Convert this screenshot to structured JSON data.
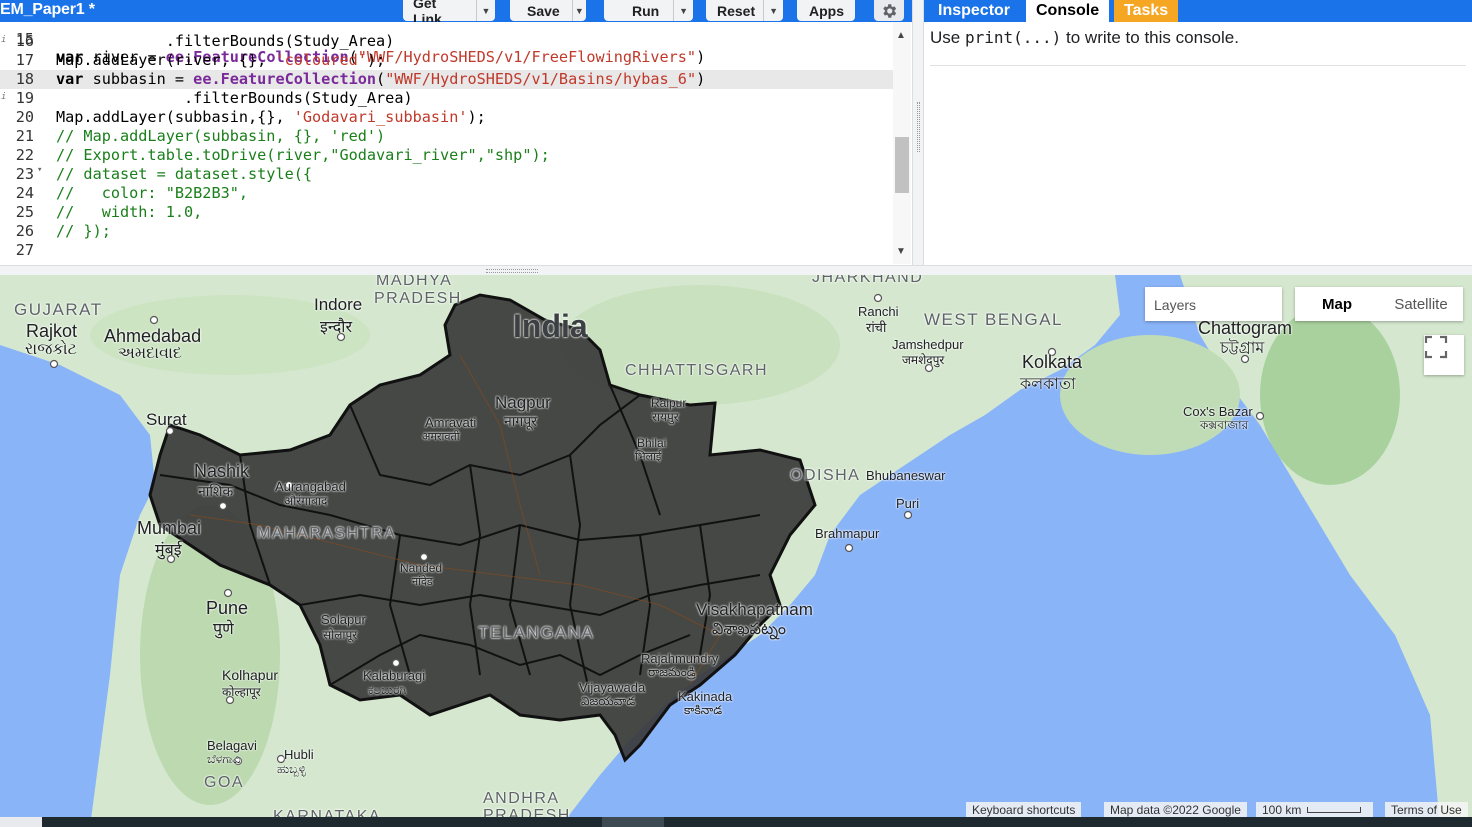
{
  "toolbar": {
    "script_title": "EM_Paper1 *",
    "get_link": "Get Link",
    "save": "Save",
    "run": "Run",
    "reset": "Reset",
    "apps": "Apps"
  },
  "editor": {
    "partial_top_line": "var river = ee.FeatureCollection(\"WWF/HydroSHEDS/v1/FreeFlowingRivers\")",
    "partial_top_line_number": "15",
    "lines": [
      {
        "n": "16",
        "text": "            .filterBounds(Study_Area)"
      },
      {
        "n": "17",
        "text": "Map.addLayer(river, {}, 'coloured');"
      },
      {
        "n": "18",
        "text": "var subbasin = ee.FeatureCollection(\"WWF/HydroSHEDS/v1/Basins/hybas_6\")"
      },
      {
        "n": "19",
        "text": "              .filterBounds(Study_Area)"
      },
      {
        "n": "20",
        "text": "Map.addLayer(subbasin,{}, 'Godavari_subbasin');"
      },
      {
        "n": "21",
        "text": "// Map.addLayer(subbasin, {}, 'red')"
      },
      {
        "n": "22",
        "text": "// Export.table.toDrive(river,\"Godavari_river\",\"shp\");"
      },
      {
        "n": "23",
        "text": "// dataset = dataset.style({"
      },
      {
        "n": "24",
        "text": "//   color: \"B2B2B3\","
      },
      {
        "n": "25",
        "text": "//   width: 1.0,"
      },
      {
        "n": "26",
        "text": "// });"
      },
      {
        "n": "27",
        "text": ""
      }
    ]
  },
  "right_panel": {
    "tabs": [
      "Inspector",
      "Console",
      "Tasks"
    ],
    "active_tab": "Console",
    "console_prefix": "Use ",
    "console_code": "print(...)",
    "console_suffix": " to write to this console."
  },
  "map": {
    "layers_label": "Layers",
    "map_type_map": "Map",
    "map_type_satellite": "Satellite",
    "places": [
      {
        "id": "gujarat",
        "text": "GUJARAT"
      },
      {
        "id": "madhya",
        "text": "MADHYA"
      },
      {
        "id": "pradesh1",
        "text": "PRADESH"
      },
      {
        "id": "jharkhand",
        "text": "JHARKHAND"
      },
      {
        "id": "indore",
        "text": "Indore"
      },
      {
        "id": "indore2",
        "text": "इन्दौर"
      },
      {
        "id": "rajkot",
        "text": "Rajkot"
      },
      {
        "id": "rajkot2",
        "text": "રાજકોટ"
      },
      {
        "id": "ahmedabad",
        "text": "Ahmedabad"
      },
      {
        "id": "ahmedabad2",
        "text": "અમદાવાદ"
      },
      {
        "id": "india",
        "text": "India"
      },
      {
        "id": "ranchi",
        "text": "Ranchi"
      },
      {
        "id": "ranchi2",
        "text": "रांची"
      },
      {
        "id": "westbengal",
        "text": "WEST BENGAL"
      },
      {
        "id": "chattogram",
        "text": "Chattogram"
      },
      {
        "id": "chattogram2",
        "text": "চট্টগ্রাম"
      },
      {
        "id": "jamshedpur",
        "text": "Jamshedpur"
      },
      {
        "id": "jamshedpur2",
        "text": "जमशेदपुर"
      },
      {
        "id": "kolkata",
        "text": "Kolkata"
      },
      {
        "id": "kolkata2",
        "text": "কলকাতা"
      },
      {
        "id": "chhattisgarh",
        "text": "CHHATTISGARH"
      },
      {
        "id": "nagpur",
        "text": "Nagpur"
      },
      {
        "id": "nagpur2",
        "text": "नागपूर"
      },
      {
        "id": "amravati",
        "text": "Amravati"
      },
      {
        "id": "amravati2",
        "text": "अमरावती"
      },
      {
        "id": "raipur",
        "text": "Raipur"
      },
      {
        "id": "raipur2",
        "text": "रायपुर"
      },
      {
        "id": "bhilai",
        "text": "Bhilai"
      },
      {
        "id": "bhilai2",
        "text": "भिलाई"
      },
      {
        "id": "surat",
        "text": "Surat"
      },
      {
        "id": "coxsbazar",
        "text": "Cox's Bazar"
      },
      {
        "id": "coxsbazar2",
        "text": "কক্সবাজার"
      },
      {
        "id": "nashik",
        "text": "Nashik"
      },
      {
        "id": "nashik2",
        "text": "नाशिक"
      },
      {
        "id": "aurangabad",
        "text": "Aurangabad"
      },
      {
        "id": "aurangabad2",
        "text": "औरंगाबाद"
      },
      {
        "id": "odisha",
        "text": "ODISHA"
      },
      {
        "id": "bhubaneswar",
        "text": "Bhubaneswar"
      },
      {
        "id": "puri",
        "text": "Puri"
      },
      {
        "id": "mumbai",
        "text": "Mumbai"
      },
      {
        "id": "mumbai2",
        "text": "मुंबई"
      },
      {
        "id": "maharashtra",
        "text": "MAHARASHTRA"
      },
      {
        "id": "brahmapur",
        "text": "Brahmapur"
      },
      {
        "id": "nanded",
        "text": "Nanded"
      },
      {
        "id": "nanded2",
        "text": "नांदेड"
      },
      {
        "id": "pune",
        "text": "Pune"
      },
      {
        "id": "pune2",
        "text": "पुणे"
      },
      {
        "id": "visakhapatnam",
        "text": "Visakhapatnam"
      },
      {
        "id": "visakhapatnam2",
        "text": "విశాఖపట్నం"
      },
      {
        "id": "solapur",
        "text": "Solapur"
      },
      {
        "id": "solapur2",
        "text": "सोलापूर"
      },
      {
        "id": "telangana",
        "text": "TELANGANA"
      },
      {
        "id": "kolhapur",
        "text": "Kolhapur"
      },
      {
        "id": "kolhapur2",
        "text": "कोल्हापूर"
      },
      {
        "id": "kalaburagi",
        "text": "Kalaburagi"
      },
      {
        "id": "kalaburagi2",
        "text": "ಕಲಬುರಗಿ"
      },
      {
        "id": "rajahmundry",
        "text": "Rajahmundry"
      },
      {
        "id": "rajahmundry2",
        "text": "రాజమండ్రి"
      },
      {
        "id": "vijayawada",
        "text": "Vijayawada"
      },
      {
        "id": "vijayawada2",
        "text": "విజయవాడ"
      },
      {
        "id": "kakinada",
        "text": "Kakinada"
      },
      {
        "id": "kakinada2",
        "text": "కాకినాడ"
      },
      {
        "id": "belagavi",
        "text": "Belagavi"
      },
      {
        "id": "belagavi2",
        "text": "ಬೆಳಗಾವಿ"
      },
      {
        "id": "hubli",
        "text": "Hubli"
      },
      {
        "id": "hubli2",
        "text": "ಹುಬ್ಬಳ್ಳಿ"
      },
      {
        "id": "goa",
        "text": "GOA"
      },
      {
        "id": "andhra",
        "text": "ANDHRA"
      },
      {
        "id": "pradesh2",
        "text": "PRADESH"
      },
      {
        "id": "karnataka",
        "text": "KARNATAKA"
      }
    ],
    "attribution": {
      "shortcuts": "Keyboard shortcuts",
      "data": "Map data ©2022 Google",
      "scale": "100 km",
      "terms": "Terms of Use"
    }
  },
  "colors": {
    "accent": "#1a73e8",
    "tasks_tab": "#f5a623",
    "water": "#8ab4f8",
    "land": "#cfe6cf",
    "basin_fill": "#3a3a3a"
  }
}
